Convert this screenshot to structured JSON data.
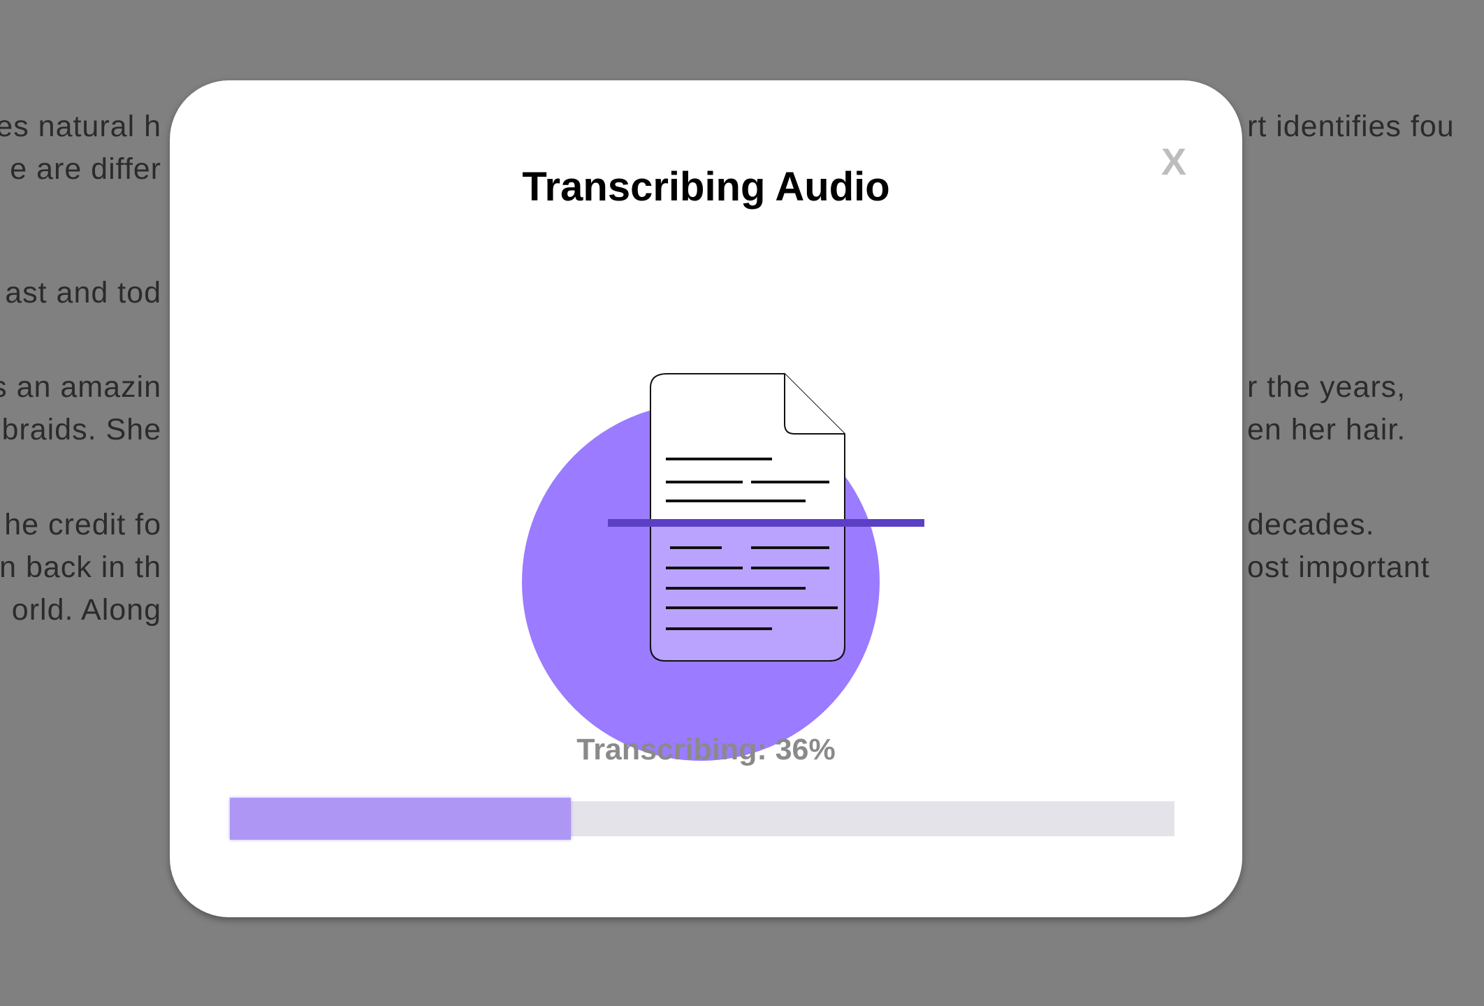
{
  "background_text": {
    "left_lines": [
      "es natural h",
      "e are differ",
      "ast and tod",
      "s an amazin",
      "braids. She",
      "he credit fo",
      "n back in th",
      "orld. Along"
    ],
    "right_lines": [
      "rt identifies fou",
      "r the years,",
      "en her hair.",
      "decades.",
      "ost important"
    ]
  },
  "modal": {
    "title": "Transcribing Audio",
    "close_label": "X",
    "progress_label": "Transcribing: 36%",
    "progress_fraction": 0.36
  },
  "colors": {
    "overlay": "#808080",
    "circle": "#9b7bff",
    "scan_line": "#5b3fc4",
    "doc_lower": "#b9a3ff",
    "progress_fill": "#ae97f4",
    "progress_track": "#e4e3ea"
  }
}
